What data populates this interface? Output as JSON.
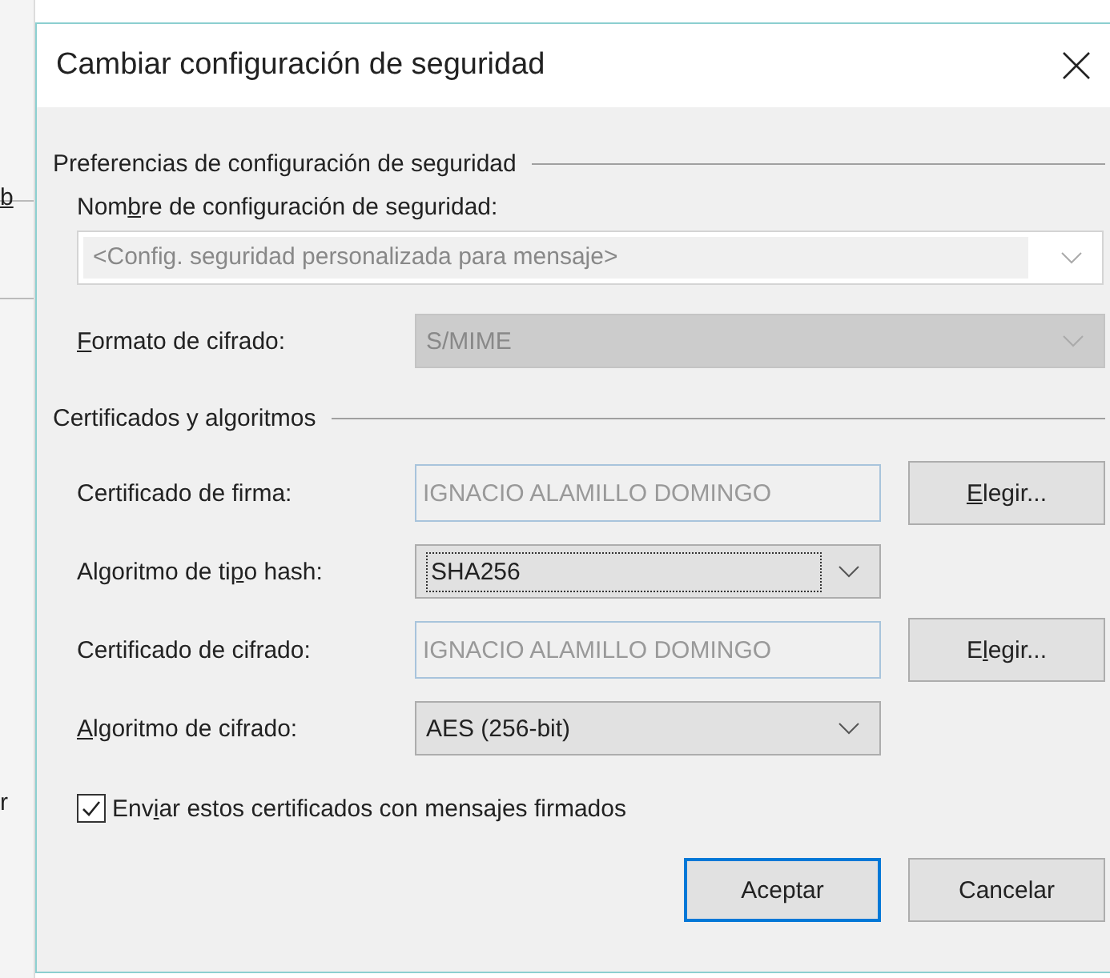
{
  "background": {
    "fragments": [
      {
        "text": "b",
        "underline": true
      },
      {
        "text": "r",
        "underline": false
      }
    ]
  },
  "dialog": {
    "title": "Cambiar configuración de seguridad",
    "sections": [
      {
        "title": "Preferencias de configuración de seguridad",
        "rows": [
          {
            "kind": "wide_combo",
            "editable": true,
            "disabled": true,
            "label": [
              {
                "t": "Nom",
                "u": false
              },
              {
                "t": "b",
                "u": true
              },
              {
                "t": "re de configuración de seguridad:",
                "u": false
              }
            ],
            "value": "<Config. seguridad personalizada para mensaje>"
          },
          {
            "kind": "wide_combo",
            "editable": false,
            "disabled": true,
            "label": [
              {
                "t": "F",
                "u": true
              },
              {
                "t": "ormato de cifrado:",
                "u": false
              }
            ],
            "value": "S/MIME"
          }
        ]
      },
      {
        "title": "Certificados y algoritmos",
        "rows": [
          {
            "kind": "certificate",
            "label": [
              {
                "t": "Certificado de firma:",
                "u": false
              }
            ],
            "value": "IGNACIO ALAMILLO DOMINGO",
            "button": [
              {
                "t": "E",
                "u": true
              },
              {
                "t": "legir...",
                "u": false
              }
            ]
          },
          {
            "kind": "combo",
            "focused": true,
            "label": [
              {
                "t": "Algoritmo de ti",
                "u": false
              },
              {
                "t": "p",
                "u": true
              },
              {
                "t": "o hash:",
                "u": false
              }
            ],
            "value": "SHA256"
          },
          {
            "kind": "certificate",
            "label": [
              {
                "t": "Certificado de cifrado:",
                "u": false
              }
            ],
            "value": "IGNACIO ALAMILLO DOMINGO",
            "button": [
              {
                "t": "E",
                "u": false
              },
              {
                "t": "l",
                "u": true
              },
              {
                "t": "egir...",
                "u": false
              }
            ]
          },
          {
            "kind": "combo",
            "focused": false,
            "label": [
              {
                "t": "A",
                "u": true
              },
              {
                "t": "lgoritmo de cifrado:",
                "u": false
              }
            ],
            "value": "AES (256-bit)"
          }
        ]
      }
    ],
    "checkbox": {
      "checked": true,
      "label": [
        {
          "t": "Env",
          "u": false
        },
        {
          "t": "i",
          "u": true
        },
        {
          "t": "ar estos certificados con mensajes firmados",
          "u": false
        }
      ]
    },
    "buttons": [
      {
        "label": "Aceptar",
        "default": true
      },
      {
        "label": "Cancelar",
        "default": false
      }
    ]
  }
}
